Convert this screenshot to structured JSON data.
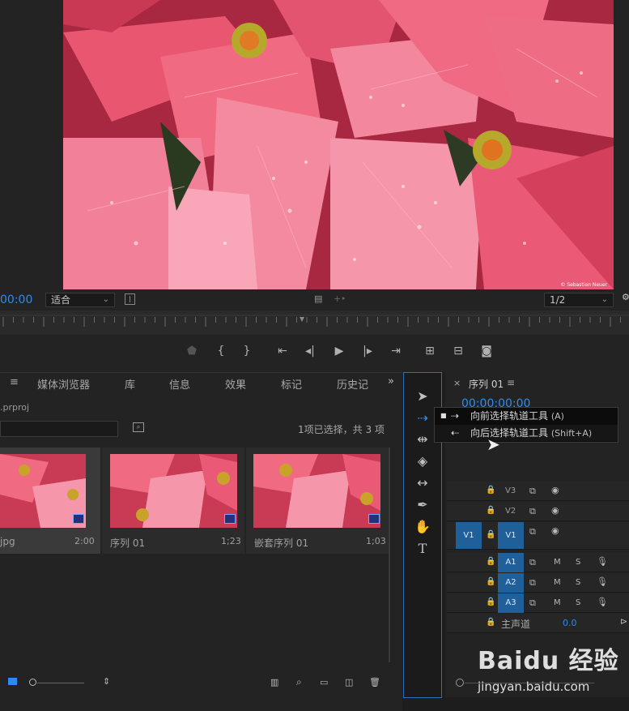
{
  "monitor": {
    "timecode_left": "00:00",
    "fit_dropdown": "适合",
    "resolution_dropdown": "1/2",
    "copyright": "© Sebastien Neuer"
  },
  "project": {
    "tabs": [
      "媒体浏览器",
      "库",
      "信息",
      "效果",
      "标记",
      "历史记"
    ],
    "filename": ".prproj",
    "selection_info": "1项已选择，共 3 项",
    "items": [
      {
        "label": "jpg",
        "duration": "2:00"
      },
      {
        "label": "序列 01",
        "duration": "1;23"
      },
      {
        "label": "嵌套序列 01",
        "duration": "1;03"
      }
    ]
  },
  "timeline": {
    "tab_title": "序列 01",
    "timecode": "00:00:00:00",
    "tracks_video": [
      "V3",
      "V2",
      "V1"
    ],
    "source_v1": "V1",
    "tracks_audio": [
      "A1",
      "A2",
      "A3"
    ],
    "track_m": "M",
    "track_s": "S",
    "master_label": "主声道",
    "master_value": "0.0"
  },
  "menu": {
    "item1_label": "向前选择轨道工具",
    "item1_shortcut": "(A)",
    "item2_label": "向后选择轨道工具",
    "item2_shortcut": "(Shift+A)"
  },
  "watermark": {
    "brand": "Baidu 经验",
    "url": "jingyan.baidu.com"
  }
}
